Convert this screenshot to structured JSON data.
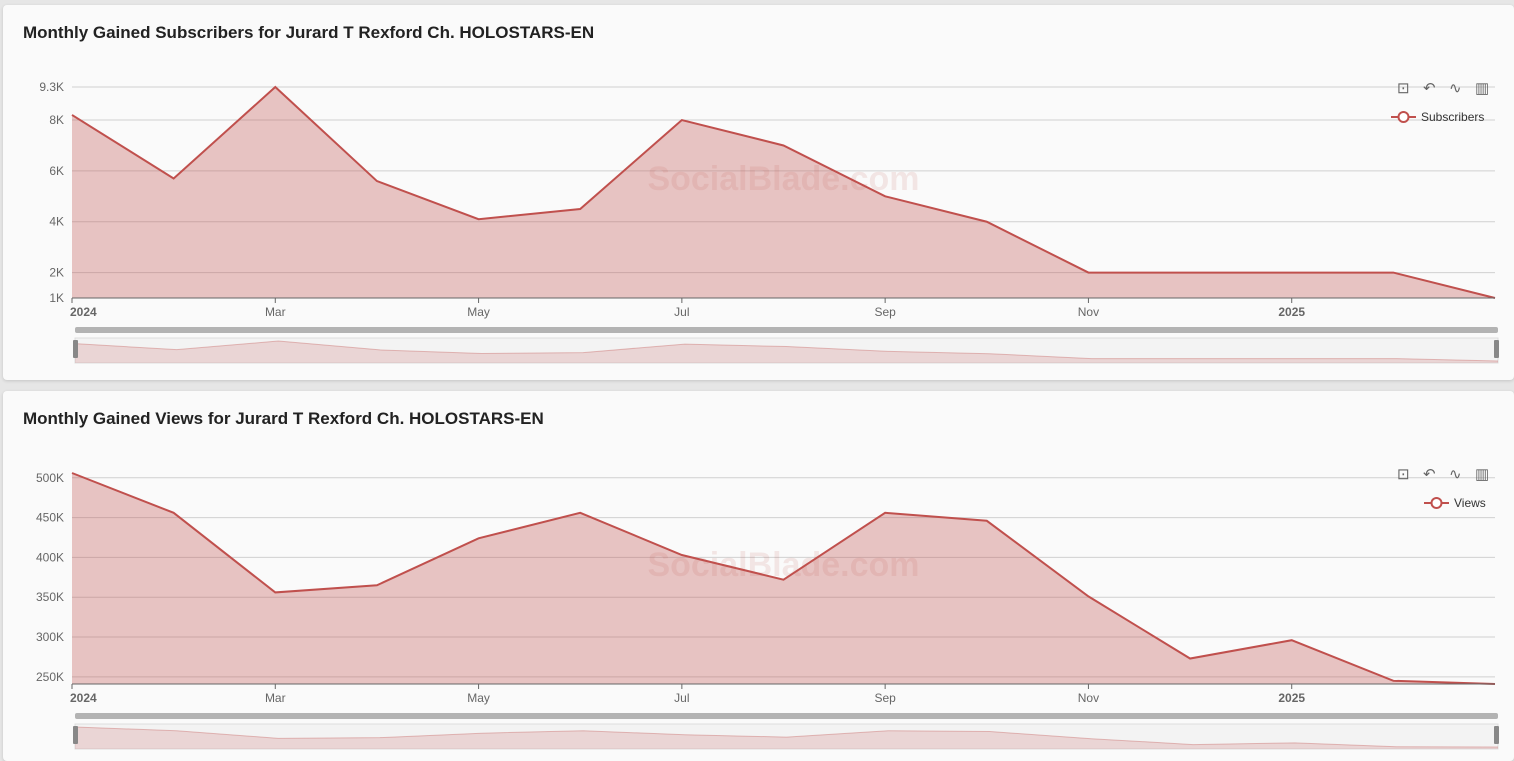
{
  "watermark": "SocialBlade.com",
  "toolbar": {
    "icons": [
      "zoom-icon",
      "zoom-reset-icon",
      "line-chart-icon",
      "bar-chart-icon"
    ]
  },
  "accent": "#c0504d",
  "chart_data": [
    {
      "type": "area",
      "title": "Monthly Gained Subscribers for Jurard T Rexford Ch. HOLOSTARS-EN",
      "legend": "Subscribers",
      "legend_position": "top-right",
      "x": [
        "Jan 2024",
        "Feb 2024",
        "Mar 2024",
        "Apr 2024",
        "May 2024",
        "Jun 2024",
        "Jul 2024",
        "Aug 2024",
        "Sep 2024",
        "Oct 2024",
        "Nov 2024",
        "Dec 2024",
        "Jan 2025",
        "Feb 2025",
        "Mar 2025"
      ],
      "values": [
        8200,
        5700,
        9300,
        5600,
        4100,
        4500,
        8000,
        7000,
        5000,
        4000,
        2000,
        2000,
        2000,
        2000,
        1000
      ],
      "ylim": [
        1000,
        9300
      ],
      "yticks": [
        {
          "v": 1000,
          "label": "1K"
        },
        {
          "v": 2000,
          "label": "2K"
        },
        {
          "v": 4000,
          "label": "4K"
        },
        {
          "v": 6000,
          "label": "6K"
        },
        {
          "v": 8000,
          "label": "8K"
        },
        {
          "v": 9300,
          "label": "9.3K"
        }
      ],
      "xticks": [
        {
          "i": 0,
          "label": "2024",
          "bold": true
        },
        {
          "i": 2,
          "label": "Mar"
        },
        {
          "i": 4,
          "label": "May"
        },
        {
          "i": 6,
          "label": "Jul"
        },
        {
          "i": 8,
          "label": "Sep"
        },
        {
          "i": 10,
          "label": "Nov"
        },
        {
          "i": 12,
          "label": "2025",
          "bold": true
        }
      ],
      "grid": true
    },
    {
      "type": "area",
      "title": "Monthly Gained Views for Jurard T Rexford Ch. HOLOSTARS-EN",
      "legend": "Views",
      "legend_position": "top-right",
      "x": [
        "Jan 2024",
        "Feb 2024",
        "Mar 2024",
        "Apr 2024",
        "May 2024",
        "Jun 2024",
        "Jul 2024",
        "Aug 2024",
        "Sep 2024",
        "Oct 2024",
        "Nov 2024",
        "Dec 2024",
        "Jan 2025",
        "Feb 2025",
        "Mar 2025"
      ],
      "values": [
        506000,
        456000,
        356000,
        365000,
        424000,
        456000,
        403000,
        372000,
        456000,
        446000,
        351000,
        273000,
        296000,
        245000,
        241000
      ],
      "ylim": [
        241000,
        506000
      ],
      "yticks": [
        {
          "v": 250000,
          "label": "250K"
        },
        {
          "v": 300000,
          "label": "300K"
        },
        {
          "v": 350000,
          "label": "350K"
        },
        {
          "v": 400000,
          "label": "400K"
        },
        {
          "v": 450000,
          "label": "450K"
        },
        {
          "v": 500000,
          "label": "500K"
        }
      ],
      "xticks": [
        {
          "i": 0,
          "label": "2024",
          "bold": true
        },
        {
          "i": 2,
          "label": "Mar"
        },
        {
          "i": 4,
          "label": "May"
        },
        {
          "i": 6,
          "label": "Jul"
        },
        {
          "i": 8,
          "label": "Sep"
        },
        {
          "i": 10,
          "label": "Nov"
        },
        {
          "i": 12,
          "label": "2025",
          "bold": true
        }
      ],
      "grid": true
    }
  ]
}
